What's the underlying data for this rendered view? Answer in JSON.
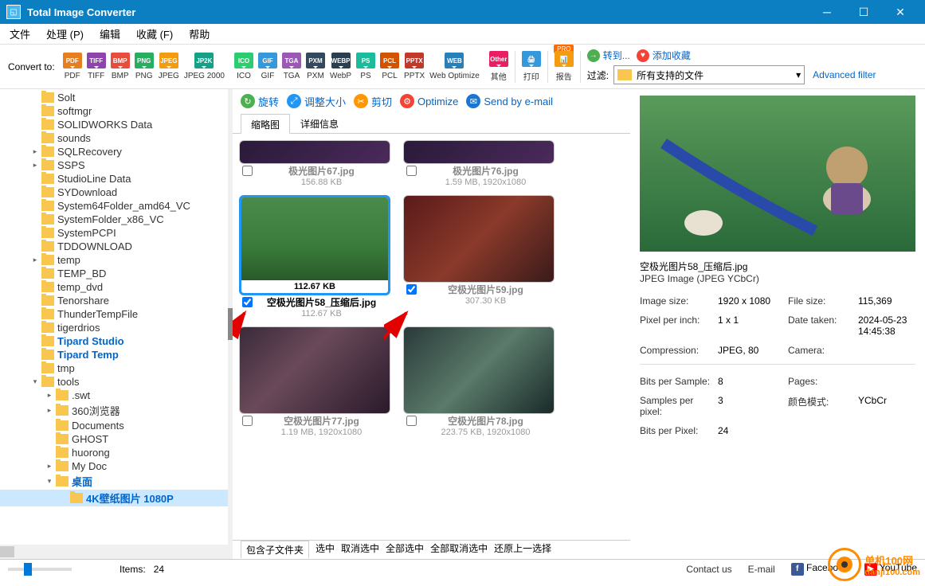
{
  "app": {
    "title": "Total Image Converter"
  },
  "menu": [
    "文件",
    "处理 (P)",
    "编辑",
    "收藏 (F)",
    "帮助"
  ],
  "convert_to": "Convert to:",
  "formats": [
    {
      "id": "pdf",
      "label": "PDF"
    },
    {
      "id": "tiff",
      "label": "TIFF"
    },
    {
      "id": "bmp",
      "label": "BMP"
    },
    {
      "id": "png",
      "label": "PNG"
    },
    {
      "id": "jpeg",
      "label": "JPEG"
    },
    {
      "id": "jp2k",
      "label": "JPEG 2000"
    }
  ],
  "formats2": [
    {
      "id": "ico",
      "label": "ICO"
    },
    {
      "id": "gif",
      "label": "GIF"
    },
    {
      "id": "tga",
      "label": "TGA"
    },
    {
      "id": "pxm",
      "label": "PXM"
    },
    {
      "id": "webp",
      "label": "WebP"
    },
    {
      "id": "ps",
      "label": "PS"
    },
    {
      "id": "pcl",
      "label": "PCL"
    },
    {
      "id": "pptx",
      "label": "PPTX"
    },
    {
      "id": "web",
      "label": "Web Optimize"
    }
  ],
  "other_btn": "其他",
  "print_btn": "打印",
  "report_btn": "报告",
  "pro": "PRO",
  "goto": "转到...",
  "add_fav": "添加收藏",
  "filter_label": "过滤:",
  "filter_value": "所有支持的文件",
  "adv_filter": "Advanced filter",
  "actions": {
    "rotate": "旋转",
    "resize": "调整大小",
    "crop": "剪切",
    "optimize": "Optimize",
    "email": "Send by e-mail"
  },
  "tabs": {
    "thumbnails": "缩略图",
    "details": "详细信息"
  },
  "tree": [
    {
      "d": 0,
      "arrow": "",
      "label": "Solt"
    },
    {
      "d": 0,
      "arrow": "",
      "label": "softmgr"
    },
    {
      "d": 0,
      "arrow": "",
      "label": "SOLIDWORKS Data"
    },
    {
      "d": 0,
      "arrow": "",
      "label": "sounds"
    },
    {
      "d": 0,
      "arrow": "▸",
      "label": "SQLRecovery"
    },
    {
      "d": 0,
      "arrow": "▸",
      "label": "SSPS"
    },
    {
      "d": 0,
      "arrow": "",
      "label": "StudioLine Data"
    },
    {
      "d": 0,
      "arrow": "",
      "label": "SYDownload"
    },
    {
      "d": 0,
      "arrow": "",
      "label": "System64Folder_amd64_VC"
    },
    {
      "d": 0,
      "arrow": "",
      "label": "SystemFolder_x86_VC"
    },
    {
      "d": 0,
      "arrow": "",
      "label": "SystemPCPI"
    },
    {
      "d": 0,
      "arrow": "",
      "label": "TDDOWNLOAD"
    },
    {
      "d": 0,
      "arrow": "▸",
      "label": "temp"
    },
    {
      "d": 0,
      "arrow": "",
      "label": "TEMP_BD"
    },
    {
      "d": 0,
      "arrow": "",
      "label": "temp_dvd"
    },
    {
      "d": 0,
      "arrow": "",
      "label": "Tenorshare"
    },
    {
      "d": 0,
      "arrow": "",
      "label": "ThunderTempFile"
    },
    {
      "d": 0,
      "arrow": "",
      "label": "tigerdrios"
    },
    {
      "d": 0,
      "arrow": "",
      "label": "Tipard Studio",
      "hl": true
    },
    {
      "d": 0,
      "arrow": "",
      "label": "Tipard Temp",
      "hl": true
    },
    {
      "d": 0,
      "arrow": "",
      "label": "tmp"
    },
    {
      "d": 0,
      "arrow": "▾",
      "label": "tools",
      "open": true
    },
    {
      "d": 1,
      "arrow": "▸",
      "label": ".swt"
    },
    {
      "d": 1,
      "arrow": "▸",
      "label": "360浏览器"
    },
    {
      "d": 1,
      "arrow": "",
      "label": "Documents"
    },
    {
      "d": 1,
      "arrow": "",
      "label": "GHOST"
    },
    {
      "d": 1,
      "arrow": "",
      "label": "huorong"
    },
    {
      "d": 1,
      "arrow": "▸",
      "label": "My Doc"
    },
    {
      "d": 1,
      "arrow": "▾",
      "label": "桌面",
      "open": true,
      "hl": true
    },
    {
      "d": 2,
      "arrow": "",
      "label": "4K壁纸图片 1080P",
      "selected": true
    }
  ],
  "cards": [
    {
      "name": "极光图片67.jpg",
      "size": "156.88 KB",
      "checked": false,
      "scene": "scene-dark"
    },
    {
      "name": "极光图片76.jpg",
      "size": "1.59 MB, 1920x1080",
      "checked": false,
      "scene": "scene-dark"
    },
    {
      "name": "空极光图片58_压缩后.jpg",
      "size": "112.67 KB",
      "checked": true,
      "selected": true,
      "scene": "scene-grass",
      "footer": "112.67 KB"
    },
    {
      "name": "空极光图片59.jpg",
      "size": "307.30 KB",
      "checked": true,
      "scene": "scene-red"
    },
    {
      "name": "空极光图片77.jpg",
      "size": "1.19 MB, 1920x1080",
      "checked": false,
      "scene": "scene-face"
    },
    {
      "name": "空极光图片78.jpg",
      "size": "223.75 KB, 1920x1080",
      "checked": false,
      "scene": "scene-dragon"
    }
  ],
  "info": {
    "name": "空极光图片58_压缩后.jpg",
    "type": "JPEG Image (JPEG YCbCr)",
    "image_size_lbl": "Image size:",
    "image_size": "1920 x 1080",
    "file_size_lbl": "File size:",
    "file_size": "115,369",
    "ppi_lbl": "Pixel per inch:",
    "ppi": "1 x 1",
    "date_lbl": "Date taken:",
    "date": "2024-05-23 14:45:38",
    "comp_lbl": "Compression:",
    "comp": "JPEG, 80",
    "cam_lbl": "Camera:",
    "bps_lbl": "Bits per Sample:",
    "bps": "8",
    "pages_lbl": "Pages:",
    "spp_lbl": "Samples per pixel:",
    "spp": "3",
    "cmode_lbl": "颜色模式:",
    "cmode": "YCbCr",
    "bpp_lbl": "Bits per Pixel:",
    "bpp": "24"
  },
  "footer_opts": [
    "包含子文件夹",
    "选中",
    "取消选中",
    "全部选中",
    "全部取消选中",
    "还原上一选择"
  ],
  "status": {
    "items_label": "Items:",
    "items_count": "24",
    "contact": "Contact us",
    "email": "E-mail",
    "fb": "Facebook",
    "yt": "YouTube"
  },
  "watermark": {
    "line1": "单机100网",
    "line2": "danji100.com"
  }
}
